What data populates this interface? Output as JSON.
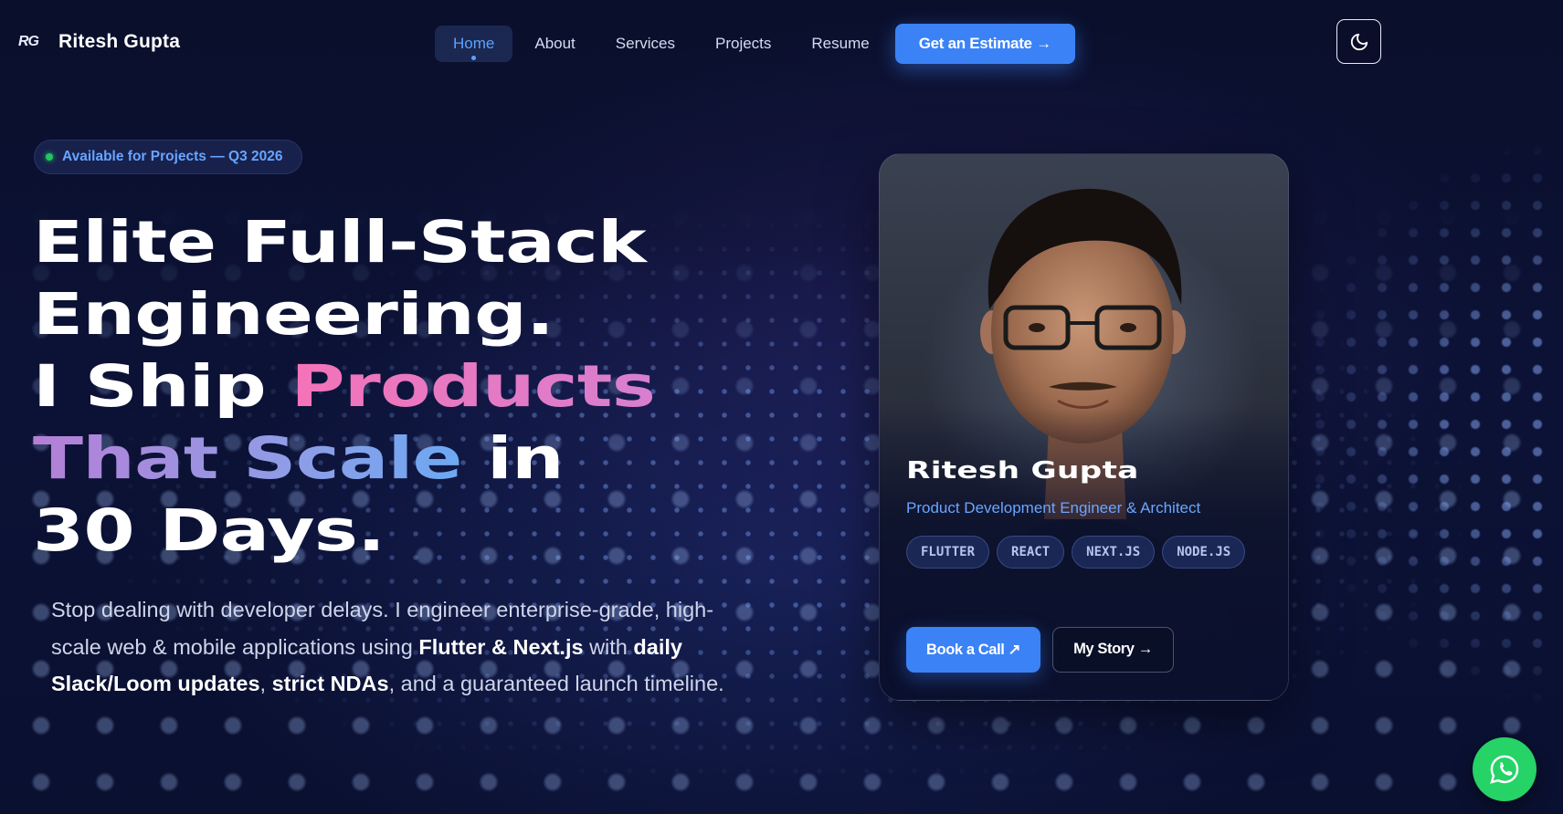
{
  "nav": {
    "logo_mark": "RG",
    "logo_name": "Ritesh Gupta",
    "links": [
      "Home",
      "About",
      "Services",
      "Projects",
      "Resume"
    ],
    "active_link": "Home",
    "cta_label": "Get an Estimate →",
    "theme_toggle_icon": "moon-icon"
  },
  "hero": {
    "badge": "Available for Projects — Q3 2026",
    "headline": {
      "line1": "Elite Full-Stack",
      "line2": "Engineering.",
      "line3_prefix": "I Ship ",
      "line3_highlight": "Products",
      "line4_highlight": "That Scale",
      "line4_suffix": " in",
      "line5": "30 Days."
    },
    "subtext": {
      "part1": "Stop dealing with developer delays. I engineer enterprise-grade, high-scale web & mobile applications using ",
      "bold1": "Flutter & Next.js",
      "part2": " with ",
      "bold2": "daily Slack/Loom updates",
      "part3": ", ",
      "bold3": "strict NDAs",
      "part4": ", and a guaranteed launch timeline."
    }
  },
  "profile_card": {
    "name": "Ritesh Gupta",
    "role": "Product Development Engineer & Architect",
    "tags": [
      "FLUTTER",
      "REACT",
      "NEXT.JS",
      "NODE.JS"
    ],
    "primary_button": "Book a Call ↗",
    "secondary_button": "My Story →"
  },
  "floating": {
    "whatsapp_icon": "whatsapp-icon"
  },
  "colors": {
    "accent": "#3b82f6",
    "link_active": "#5aa2ff",
    "status_green": "#22c55e",
    "highlight_pink": "#f473b8",
    "highlight_purple_blue": "#8f9de6",
    "whatsapp": "#25d366"
  }
}
